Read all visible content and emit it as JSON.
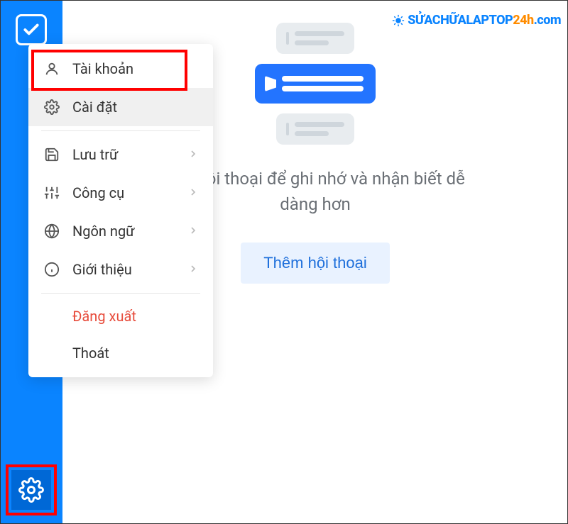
{
  "menu": {
    "account": "Tài khoản",
    "settings": "Cài đặt",
    "storage": "Lưu trữ",
    "tools": "Công cụ",
    "language": "Ngôn ngữ",
    "about": "Giới thiệu",
    "logout": "Đăng xuất",
    "exit": "Thoát"
  },
  "main": {
    "hint_line": "loại hội thoại để ghi nhớ và nhận biết dễ dàng hơn",
    "add_button": "Thêm hội thoại"
  },
  "watermark": {
    "p1": "SỬACHỮALAPTOP",
    "p2": "24h",
    "p3": ".com"
  },
  "colors": {
    "primary": "#0a84ff",
    "highlight": "#ff0000",
    "logout": "#e74c3c"
  }
}
